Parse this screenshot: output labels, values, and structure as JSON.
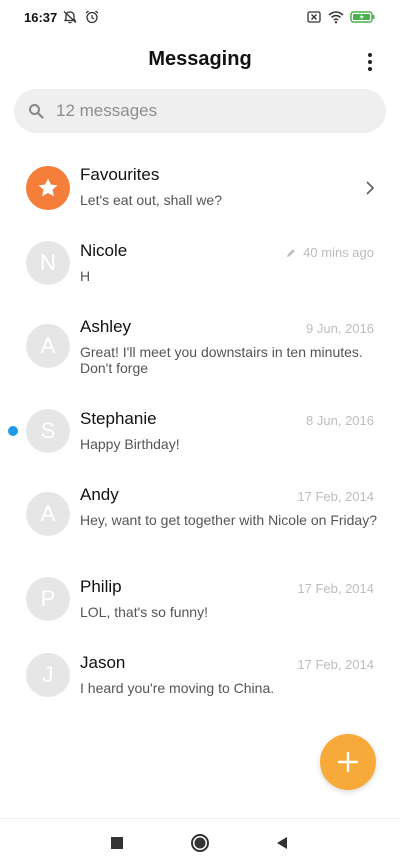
{
  "status_bar": {
    "time": "16:37",
    "left_icons": [
      "mute-notification-icon",
      "alarm-icon"
    ],
    "right_icons": [
      "sim-off-icon",
      "wifi-icon",
      "battery-charging-icon"
    ],
    "battery_color": "#4caf50"
  },
  "header": {
    "title": "Messaging"
  },
  "search": {
    "placeholder": "12 messages"
  },
  "conversations": [
    {
      "name": "Favourites",
      "preview": "Let's eat out, shall we?",
      "date": "",
      "avatar_icon": "star-icon",
      "avatar_color": "#f47e3a"
    },
    {
      "name": "Nicole",
      "initial": "N",
      "preview": "H",
      "date": "40 mins ago",
      "draft": true
    },
    {
      "name": "Ashley",
      "initial": "A",
      "preview": "Great! I'll meet you downstairs in ten minutes. Don't forge",
      "date": "9 Jun, 2016"
    },
    {
      "name": "Stephanie",
      "initial": "S",
      "preview": "Happy Birthday!",
      "date": "8 Jun, 2016",
      "unread": true
    },
    {
      "name": "Andy",
      "initial": "A",
      "preview": "Hey, want to get together with Nicole on Friday?",
      "date": "17 Feb, 2014"
    },
    {
      "name": "Philip",
      "initial": "P",
      "preview": "LOL, that's so funny!",
      "date": "17 Feb, 2014"
    },
    {
      "name": "Jason",
      "initial": "J",
      "preview": "I heard you're moving to China.",
      "date": "17 Feb, 2014"
    }
  ],
  "fab": {
    "icon": "plus-icon",
    "color": "#f7a93a"
  },
  "nav": {
    "icons": [
      "recents-square-icon",
      "home-circle-icon",
      "back-triangle-icon"
    ]
  },
  "colors": {
    "unread_dot": "#1e9be8"
  }
}
